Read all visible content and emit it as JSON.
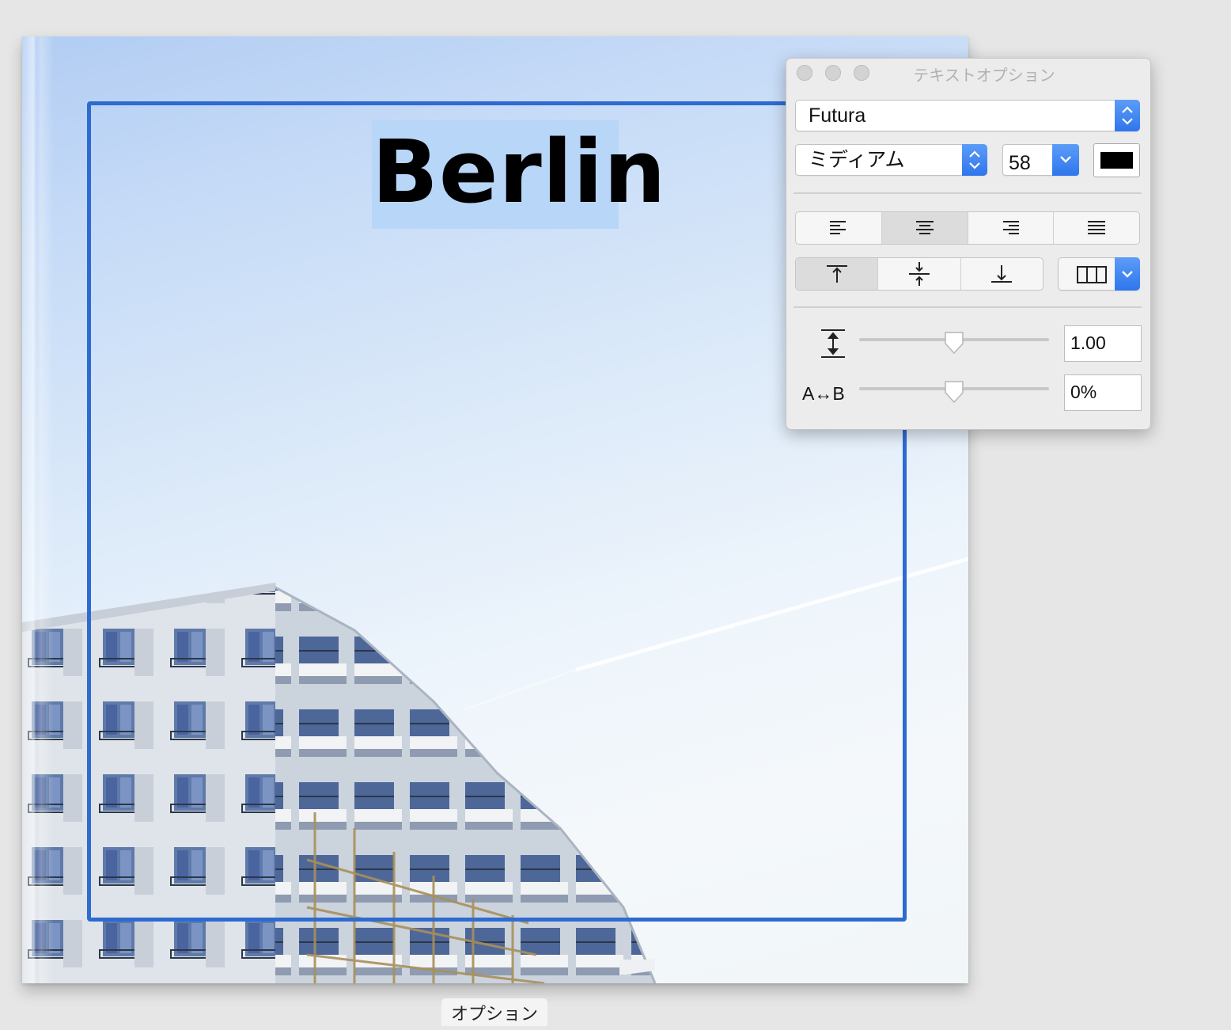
{
  "document": {
    "title_text": "Berlin",
    "options_tab_label": "オプション"
  },
  "panel": {
    "title": "テキストオプション",
    "font_family": "Futura",
    "font_style": "ミディアム",
    "font_size": "58",
    "text_color": "#000000",
    "horizontal_alignment": {
      "options": [
        "left",
        "center",
        "right",
        "justify"
      ],
      "selected": "center"
    },
    "vertical_alignment": {
      "options": [
        "top",
        "middle",
        "bottom"
      ],
      "selected": "top"
    },
    "line_spacing_value": "1.00",
    "line_spacing_level": 0.5,
    "character_spacing_label": "A↔B",
    "character_spacing_value": "0%",
    "character_spacing_level": 0.5
  },
  "colors": {
    "frame_blue": "#2e6bd1",
    "title_highlight": "#b8d6f8",
    "accent_blue": "#3b82f6"
  }
}
